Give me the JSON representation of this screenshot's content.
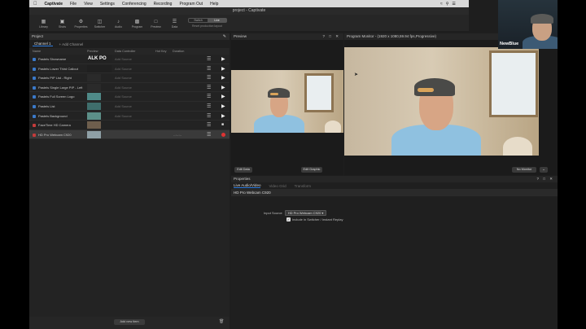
{
  "menubar": {
    "items": [
      "Captivate",
      "File",
      "View",
      "Settings",
      "Conferencing",
      "Recording",
      "Program Out",
      "Help"
    ]
  },
  "window": {
    "title": "project - Captivate"
  },
  "toolbar": {
    "items": [
      {
        "label": "Library",
        "icon": "library-icon"
      },
      {
        "label": "Shots",
        "icon": "shots-icon"
      },
      {
        "label": "Properties",
        "icon": "properties-icon"
      },
      {
        "label": "Switcher",
        "icon": "switcher-icon"
      },
      {
        "label": "Audio",
        "icon": "audio-icon"
      },
      {
        "label": "Program",
        "icon": "program-icon"
      },
      {
        "label": "Preview",
        "icon": "preview-icon"
      },
      {
        "label": "Data",
        "icon": "data-icon"
      }
    ],
    "switch": [
      "Switch",
      "Live"
    ],
    "layout_label": "Reset production layout"
  },
  "project": {
    "title": "Project",
    "channel_tab": "Channel 1",
    "add_channel": "+ Add Channel",
    "columns": {
      "name": "Name",
      "preview": "Preview",
      "data": "Data Controller",
      "hotkey": "Hot Key",
      "duration": "Duration"
    },
    "rows": [
      {
        "name": "Pastels Showname",
        "data": "Add Source",
        "color": "#3a79c9",
        "action": "play",
        "thumb": "ALK PO"
      },
      {
        "name": "Pastels Lower Third Callout",
        "data": "Add Source",
        "color": "#3a79c9",
        "action": "play",
        "thumb": ""
      },
      {
        "name": "Pastels PIP List - Right",
        "data": "Add Source",
        "color": "#3a79c9",
        "action": "play",
        "thumb": ""
      },
      {
        "name": "Pastels Single Large PIP - Left",
        "data": "Add Source",
        "color": "#3a79c9",
        "action": "play",
        "thumb": ""
      },
      {
        "name": "Pastels Full Screen Logo",
        "data": "Add Source",
        "color": "#3a79c9",
        "action": "play",
        "thumb": ""
      },
      {
        "name": "Pastels List",
        "data": "Add Source",
        "color": "#3a79c9",
        "action": "play",
        "thumb": ""
      },
      {
        "name": "Pastels Background",
        "data": "Add Source",
        "color": "#3a79c9",
        "action": "play",
        "thumb": ""
      },
      {
        "name": "FaceTime HD Camera",
        "data": "",
        "color": "#c43b3b",
        "action": "camera",
        "thumb": ""
      },
      {
        "name": "HD Pro Webcam C920",
        "data": "",
        "color": "#c43b3b",
        "action": "record",
        "thumb": "",
        "duration": "--:--:--"
      }
    ],
    "add_item": "Add new item"
  },
  "preview": {
    "title": "Preview",
    "edit_data": "Edit Data",
    "edit_graphic": "Edit Graphic"
  },
  "program": {
    "title": "Program Monitor - (1920 x 1080,59.94 fps,Progressive)",
    "monitor": "No Monitor"
  },
  "properties": {
    "title": "Properties",
    "tabs": [
      "Live Audio/Video",
      "Video Grid",
      "Transform"
    ],
    "selected_name": "HD Pro Webcam C920",
    "input_label": "Input Source",
    "input_value": "HD Pro Webcam C920",
    "checkbox_label": "Include in Switcher / Instant Replay"
  },
  "webcam": {
    "badge": "NewBlue"
  }
}
